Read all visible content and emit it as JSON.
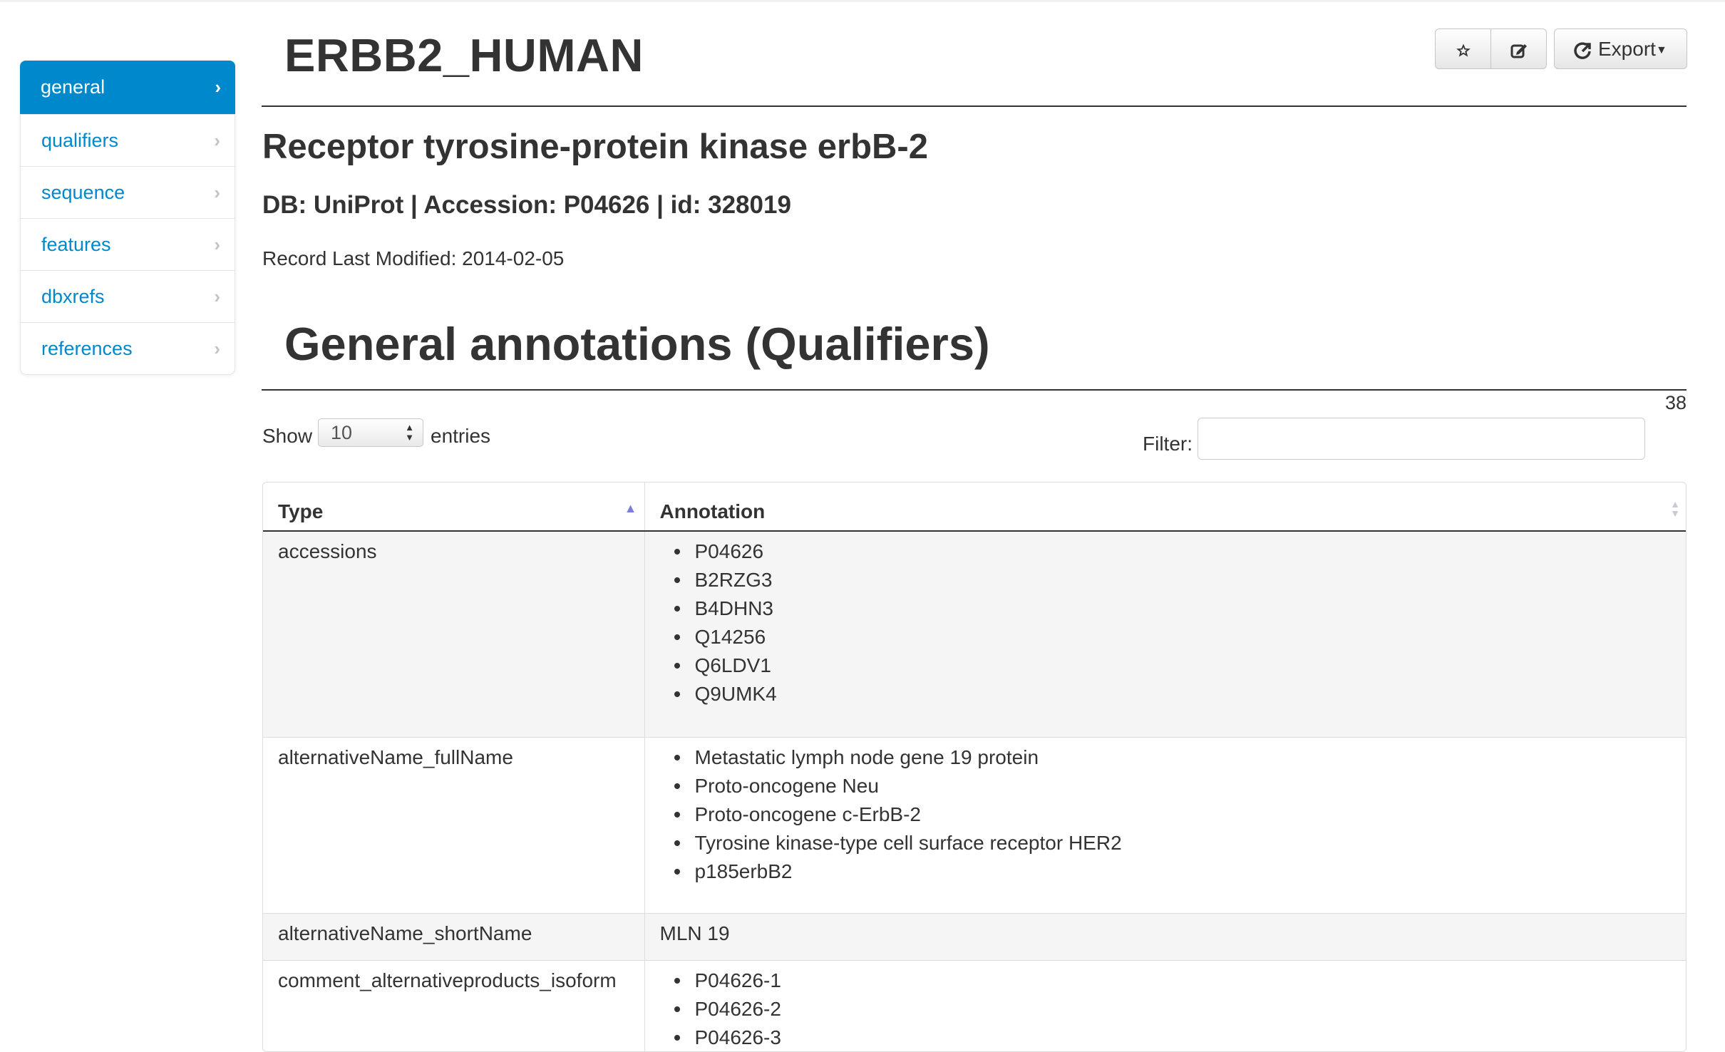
{
  "sidebar": {
    "items": [
      {
        "label": "general",
        "active": true
      },
      {
        "label": "qualifiers"
      },
      {
        "label": "sequence"
      },
      {
        "label": "features"
      },
      {
        "label": "dbxrefs"
      },
      {
        "label": "references"
      }
    ]
  },
  "header": {
    "title": "ERBB2_HUMAN",
    "export_label": "Export",
    "star_icon": "star-icon",
    "edit_icon": "edit-icon",
    "export_icon": "export-icon"
  },
  "record": {
    "name": "Receptor tyrosine-protein kinase erbB-2",
    "db_line": "DB: UniProt | Accession: P04626 | id: 328019",
    "modified": "Record Last Modified: 2014-02-05"
  },
  "section": {
    "title": "General annotations (Qualifiers)",
    "count": "38"
  },
  "controls": {
    "show_label": "Show",
    "entries_value": "10",
    "entries_label": "entries",
    "filter_label": "Filter:",
    "filter_value": ""
  },
  "table": {
    "headers": [
      "Type",
      "Annotation"
    ],
    "rows": [
      {
        "type": "accessions",
        "values": [
          "P04626",
          "B2RZG3",
          "B4DHN3",
          "Q14256",
          "Q6LDV1",
          "Q9UMK4"
        ]
      },
      {
        "type": "alternativeName_fullName",
        "values": [
          "Metastatic lymph node gene 19 protein",
          "Proto-oncogene Neu",
          "Proto-oncogene c-ErbB-2",
          "Tyrosine kinase-type cell surface receptor HER2",
          "p185erbB2"
        ]
      },
      {
        "type": "alternativeName_shortName",
        "text": "MLN 19"
      },
      {
        "type": "comment_alternativeproducts_isoform",
        "values": [
          "P04626-1",
          "P04626-2",
          "P04626-3"
        ]
      }
    ]
  },
  "colors": {
    "accent": "#0088cc",
    "text": "#333333",
    "stripe": "#f5f5f5"
  }
}
